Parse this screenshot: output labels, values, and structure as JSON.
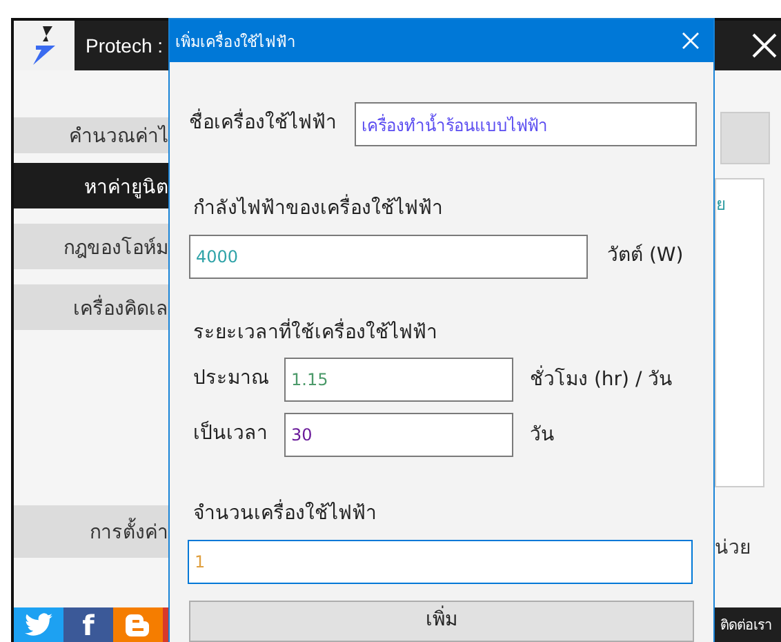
{
  "main_window": {
    "title": "Protech :",
    "sidebar": {
      "items": [
        {
          "label": "คำนวณค่าไ",
          "selected": false
        },
        {
          "label": "หาค่ายูนิต",
          "selected": true
        },
        {
          "label": "กฎของโอห์ม",
          "selected": false
        },
        {
          "label": "เครื่องคิดเล",
          "selected": false
        }
      ],
      "bottom_items": [
        {
          "label": "การตั้งค่า",
          "selected": false
        }
      ]
    },
    "right_panel": {
      "list_text": "ย",
      "unit_text": "น่วย"
    },
    "footer": {
      "social": [
        {
          "kind": "twitter",
          "color": "#1da1f2"
        },
        {
          "kind": "facebook",
          "color": "#3b5998",
          "glyph": "f"
        },
        {
          "kind": "blogger",
          "color": "#f57d00"
        },
        {
          "kind": "other",
          "color": "#d83a2b"
        }
      ],
      "contact_link": "ติดต่อเรา"
    }
  },
  "dialog": {
    "title": "เพิ่มเครื่องใช้ไฟฟ้า",
    "name": {
      "label": "ชื่อเครื่องใช้ไฟฟ้า",
      "value": "เครื่องทำน้ำร้อนแบบไฟฟ้า",
      "color": "#5a4cf0",
      "focused": false
    },
    "power": {
      "label": "กำลังไฟฟ้าของเครื่องใช้ไฟฟ้า",
      "value": "4000",
      "color": "#2fa3a8",
      "unit": "วัตต์ (W)",
      "focused": false
    },
    "duration": {
      "label": "ระยะเวลาที่ใช้เครื่องใช้ไฟฟ้า",
      "rows": [
        {
          "label": "ประมาณ",
          "value": "1.15",
          "color": "#4c9a6a",
          "unit": "ชั่วโมง (hr) / วัน",
          "focused": false
        },
        {
          "label": "เป็นเวลา",
          "value": "30",
          "color": "#6a1b9a",
          "unit": "วัน",
          "focused": false
        }
      ]
    },
    "count": {
      "label": "จำนวนเครื่องใช้ไฟฟ้า",
      "value": "1",
      "color": "#e0a040",
      "focused": true
    },
    "add_button": "เพิ่ม"
  }
}
